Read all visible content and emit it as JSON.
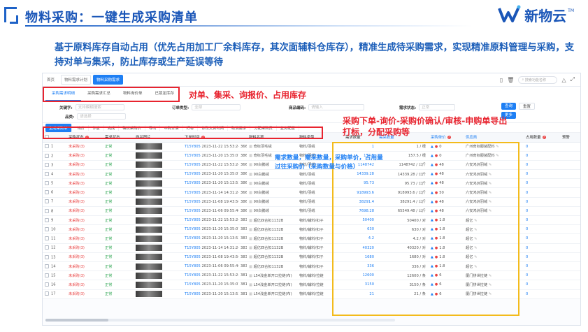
{
  "header": {
    "title": "物料采购：一键生成采购清单",
    "brand_name": "新物云",
    "brand_tm": "TM",
    "brand_color": "#1a56b8"
  },
  "intro": "基于原料库存自动占用（优先占用加工厂余料库存，其次面辅料仓库存），精准生成待采购需求，实现精准原料管理与采购，支持对单与集采，防止库存或生产延误等待",
  "app": {
    "breadcrumb": [
      "首页",
      "物料需求计划"
    ],
    "active_tab": "物料采购需求",
    "search_placeholder": "搜索功能名称",
    "subtabs": [
      "采购需求明细",
      "采购需求汇总",
      "物料询价单",
      "已锁定库存"
    ],
    "filters": {
      "keyword_label": "关键字:",
      "keyword_placeholder": "支持模糊搜索",
      "order_type_label": "订单类型:",
      "order_type_value": "全部",
      "goods_code_label": "商品编码:",
      "goods_code_placeholder": "请输入",
      "req_status_label": "需求状态:",
      "req_status_value": "正常",
      "category_label": "品类:",
      "category_value": "请选择",
      "query_btn": "查询",
      "reset_btn": "重置",
      "expand_btn": "更多"
    },
    "toolbar": [
      "生成采购单",
      "询价",
      "作废",
      "完成",
      "确认采购价",
      "导出",
      "申购详情",
      "打标",
      "修改交货时间",
      "取消需求",
      "分配采购员",
      "业务配置"
    ],
    "columns": [
      "",
      "采购状态",
      "需求状态",
      "商品图片",
      "",
      "下单时间",
      "",
      "物料名称",
      "物料类型",
      "需求数量",
      "需采数量",
      "采购单价",
      "供应商",
      "占用数量",
      "预警"
    ],
    "rows": [
      {
        "no": "1",
        "status": "未采购(3)",
        "req": "正常",
        "code": "T15Y805",
        "time": "2023-11-22 15:53:24",
        "num": "366",
        "name": "奇标羽毛绒",
        "type": "物料/羽绒",
        "req_qty": "1",
        "need_qty": "1 / 根",
        "price": "0",
        "supplier": "广州奇标服装配料",
        "occupy": "0"
      },
      {
        "no": "2",
        "status": "未采购(3)",
        "req": "正常",
        "code": "T15Y805",
        "time": "2023-11-20 15:35:07",
        "num": "386",
        "name": "奇标羽毛绒",
        "type": "物料/羽绒",
        "req_qty": "157.5",
        "need_qty": "157.5 / 根",
        "price": "0",
        "supplier": "广州奇标服装配料",
        "occupy": "0"
      },
      {
        "no": "3",
        "status": "未采购(3)",
        "req": "正常",
        "code": "T15Y805",
        "time": "2023-11-22 15:53:24",
        "num": "366",
        "name": "90白鹅绒",
        "type": "物料/羽绒",
        "req_qty": "1148742",
        "need_qty": "1148742 / 公斤",
        "price": "48",
        "supplier": "六安鸿洲羽绒",
        "occupy": "0"
      },
      {
        "no": "4",
        "status": "未采购(3)",
        "req": "正常",
        "code": "T15Y805",
        "time": "2023-11-20 15:35:07",
        "num": "386",
        "name": "90白鹅绒",
        "type": "物料/羽绒",
        "req_qty": "14339.28",
        "need_qty": "14339.28 / 公斤",
        "price": "48",
        "supplier": "六安鸿洲羽绒",
        "occupy": "0"
      },
      {
        "no": "5",
        "status": "未采购(3)",
        "req": "正常",
        "code": "T15Y805",
        "time": "2023-11-20 15:13:53",
        "num": "386",
        "name": "90白鹅绒",
        "type": "物料/羽绒",
        "req_qty": "95.73",
        "need_qty": "95.73 / 公斤",
        "price": "48",
        "supplier": "六安鸿洲羽绒",
        "occupy": "0"
      },
      {
        "no": "6",
        "status": "未采购(3)",
        "req": "正常",
        "code": "T15Y805",
        "time": "2023-11-14 14:31:24",
        "num": "366",
        "name": "90白鹅绒",
        "type": "物料/羽绒",
        "req_qty": "918993.6",
        "need_qty": "918993.6 / 公斤",
        "price": "50",
        "supplier": "六安鸿洲羽绒",
        "occupy": "0"
      },
      {
        "no": "7",
        "status": "未采购(3)",
        "req": "正常",
        "code": "T15Y805",
        "time": "2023-11-08 19:43:56",
        "num": "386",
        "name": "90白鹅绒",
        "type": "物料/羽绒",
        "req_qty": "38291.4",
        "need_qty": "38291.4 / 公斤",
        "price": "48",
        "supplier": "六安鸿洲羽绒",
        "occupy": "0"
      },
      {
        "no": "8",
        "status": "未采购(3)",
        "req": "正常",
        "code": "T15Y805",
        "time": "2023-11-06 09:55:40",
        "num": "386",
        "name": "90白鹅绒",
        "type": "物料/羽绒",
        "req_qty": "7698.28",
        "need_qty": "65549.48 / 公斤",
        "price": "48",
        "supplier": "六安鸿洲羽绒",
        "occupy": "0"
      },
      {
        "no": "9",
        "status": "未采购(3)",
        "req": "正常",
        "code": "T15Y805",
        "time": "2023-11-22 15:53:24",
        "num": "383",
        "name": "超亿四合扣1132B",
        "type": "物料/辅料/扣子",
        "req_qty": "50400",
        "need_qty": "50400 / 对",
        "price": "1.8",
        "supplier": "超亿",
        "occupy": "0"
      },
      {
        "no": "10",
        "status": "未采购(3)",
        "req": "正常",
        "code": "T15Y805",
        "time": "2023-11-20 15:35:07",
        "num": "383",
        "name": "超亿四合扣1132B",
        "type": "物料/辅料/扣子",
        "req_qty": "630",
        "need_qty": "630 / 对",
        "price": "1.8",
        "supplier": "超亿",
        "occupy": "0"
      },
      {
        "no": "11",
        "status": "未采购(3)",
        "req": "正常",
        "code": "T15Y805",
        "time": "2023-11-20 15:13:53",
        "num": "383",
        "name": "超亿四合扣1132B",
        "type": "物料/辅料/扣子",
        "req_qty": "4.2",
        "need_qty": "4.2 / 对",
        "price": "1.8",
        "supplier": "超亿",
        "occupy": "0"
      },
      {
        "no": "12",
        "status": "未采购(3)",
        "req": "正常",
        "code": "T15Y805",
        "time": "2023-11-14 14:31:24",
        "num": "383",
        "name": "超亿四合扣1132B",
        "type": "物料/辅料/扣子",
        "req_qty": "40320",
        "need_qty": "40320 / 对",
        "price": "1.8",
        "supplier": "超亿",
        "occupy": "0"
      },
      {
        "no": "13",
        "status": "未采购(3)",
        "req": "正常",
        "code": "T15Y805",
        "time": "2023-11-08 19:43:56",
        "num": "383",
        "name": "超亿四合扣1132B",
        "type": "物料/辅料/扣子",
        "req_qty": "1680",
        "need_qty": "1680 / 对",
        "price": "1.8",
        "supplier": "超亿",
        "occupy": "0"
      },
      {
        "no": "14",
        "status": "未采购(3)",
        "req": "正常",
        "code": "T15Y805",
        "time": "2023-11-06 09:55:40",
        "num": "383",
        "name": "超亿四合扣1132B",
        "type": "物料/辅料/扣子",
        "req_qty": "336",
        "need_qty": "336 / 对",
        "price": "1.8",
        "supplier": "超亿",
        "occupy": "0"
      },
      {
        "no": "15",
        "status": "未采购(3)",
        "req": "正常",
        "code": "T15Y805",
        "time": "2023-11-22 15:53:24",
        "num": "381",
        "name": "L54浅金单开口拉链(布)",
        "type": "物料/辅料/拉链",
        "req_qty": "12600",
        "need_qty": "12600 / 条",
        "price": "6",
        "supplier": "厦门拼世拉链",
        "occupy": "0"
      },
      {
        "no": "16",
        "status": "未采购(3)",
        "req": "正常",
        "code": "T15Y805",
        "time": "2023-11-20 15:35:07",
        "num": "381",
        "name": "L54浅金单开口拉链(布)",
        "type": "物料/辅料/拉链",
        "req_qty": "3150",
        "need_qty": "3150 / 条",
        "price": "6",
        "supplier": "厦门拼世拉链",
        "occupy": "0"
      },
      {
        "no": "17",
        "status": "未采购(3)",
        "req": "正常",
        "code": "T15Y805",
        "time": "2023-11-20 15:13:53",
        "num": "381",
        "name": "L54浅金单开口拉链(布)",
        "type": "物料/辅料/拉链",
        "req_qty": "21",
        "need_qty": "21 / 条",
        "price": "6",
        "supplier": "厦门拼世拉链",
        "occupy": "0"
      }
    ]
  },
  "annotations": {
    "tabs_note": "对单、集采、询报价、占用库存",
    "toolbar_note_1": "采购下单-询价-采购价确认/审核-申购单导出",
    "toolbar_note_2": "打标，分配采购等",
    "columns_note_1": "需求数量，需采数量，采购单价，占用量",
    "columns_note_2": "过往采购价（采购数量与价格）",
    "red_color": "#e8242f",
    "yellow_color": "#f3bb1c"
  }
}
